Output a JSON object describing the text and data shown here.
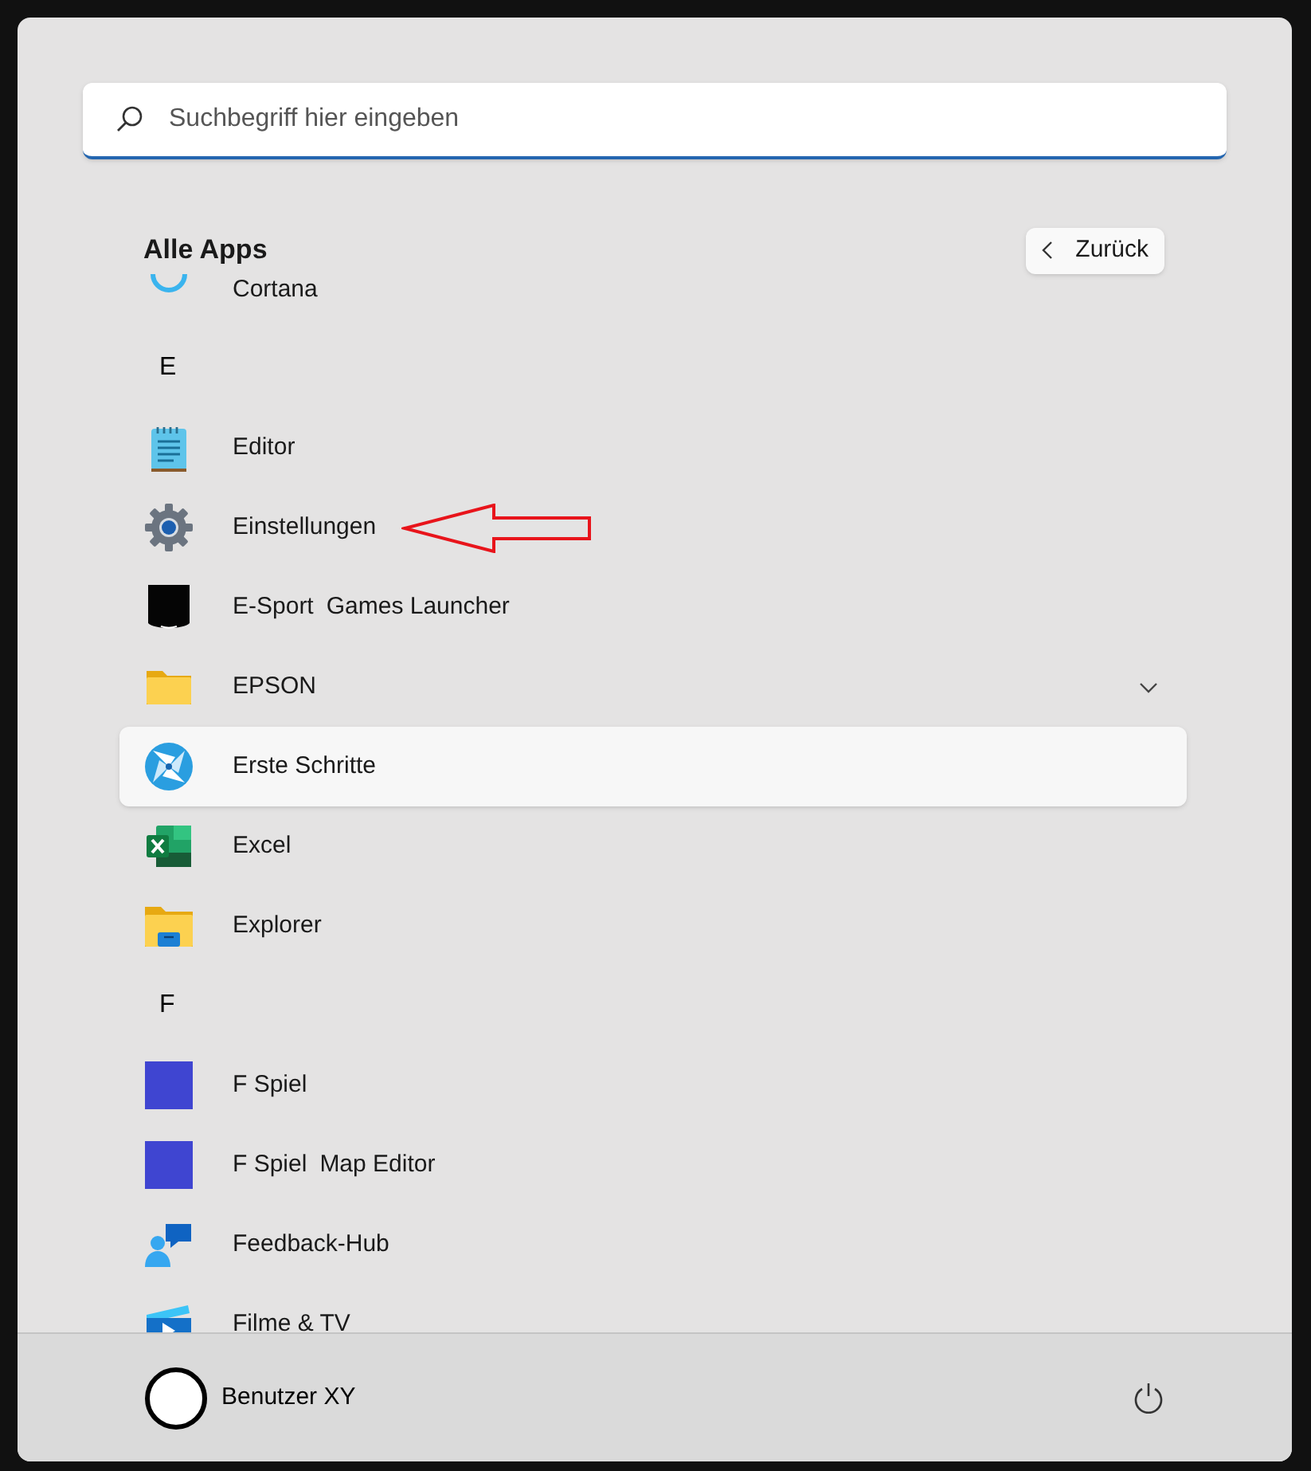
{
  "search": {
    "placeholder": "Suchbegriff hier eingeben"
  },
  "header": {
    "title": "Alle Apps",
    "back_button": "Zurück"
  },
  "items": [
    {
      "kind": "app",
      "label": "Cortana",
      "selected": false
    },
    {
      "kind": "letter",
      "label": "E"
    },
    {
      "kind": "app",
      "label": "Editor",
      "selected": false
    },
    {
      "kind": "app",
      "label": "Einstellungen",
      "selected": false,
      "annotated": true
    },
    {
      "kind": "app",
      "label": "E-Sport",
      "suffix": "Games Launcher",
      "selected": false
    },
    {
      "kind": "folder",
      "label": "EPSON",
      "selected": false,
      "expanded": false
    },
    {
      "kind": "app",
      "label": "Erste Schritte",
      "selected": true
    },
    {
      "kind": "app",
      "label": "Excel",
      "selected": false
    },
    {
      "kind": "app",
      "label": "Explorer",
      "selected": false
    },
    {
      "kind": "letter",
      "label": "F"
    },
    {
      "kind": "app",
      "label": "F Spiel",
      "selected": false
    },
    {
      "kind": "app",
      "label": "F Spiel",
      "suffix": "Map Editor",
      "selected": false
    },
    {
      "kind": "app",
      "label": "Feedback-Hub",
      "selected": false
    },
    {
      "kind": "app",
      "label": "Filme & TV",
      "selected": false
    }
  ],
  "user": {
    "name": "Benutzer XY"
  }
}
